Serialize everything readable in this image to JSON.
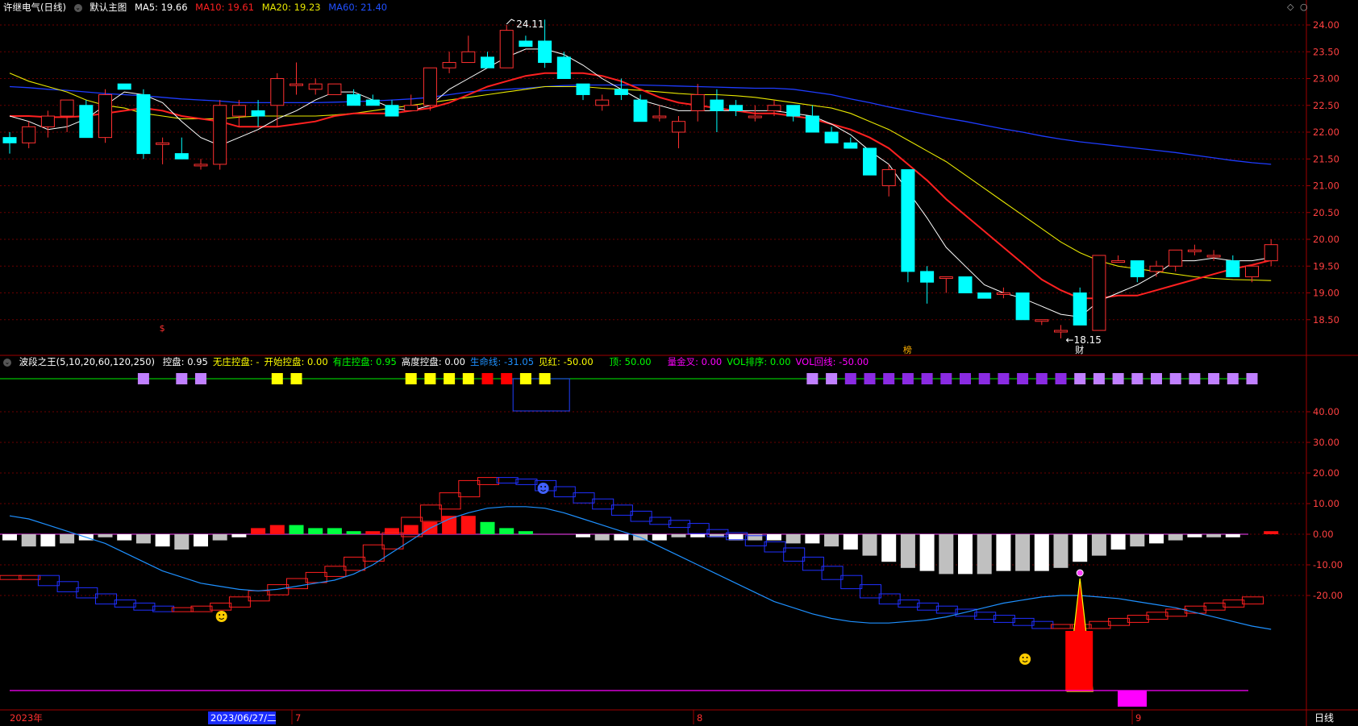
{
  "header_main": {
    "stock_name": "许继电气(日线)",
    "template_label": "默认主图",
    "ma5": "MA5: 19.66",
    "ma10": "MA10: 19.61",
    "ma20": "MA20: 19.23",
    "ma60": "MA60: 21.40"
  },
  "header_indicator": {
    "name": "波段之王(5,10,20,60,120,250)",
    "items": [
      {
        "text": "控盘: 0.95",
        "color": "#ffffff"
      },
      {
        "text": "无庄控盘: -",
        "color": "#ffff00"
      },
      {
        "text": "开始控盘: 0.00",
        "color": "#ffff00"
      },
      {
        "text": "有庄控盘: 0.95",
        "color": "#00ff00"
      },
      {
        "text": "高度控盘: 0.00",
        "color": "#ffffff"
      },
      {
        "text": "生命线: -31.05",
        "color": "#1e90ff"
      },
      {
        "text": "见红: -50.00",
        "color": "#ffff00"
      },
      {
        "text": "顶: 50.00",
        "color": "#00ff00"
      },
      {
        "text": "量金叉: 0.00",
        "color": "#ff00ff"
      },
      {
        "text": "VOL排序: 0.00",
        "color": "#00ff00"
      },
      {
        "text": "VOL回线: -50.00",
        "color": "#ff00ff"
      }
    ]
  },
  "axis_main_labels": [
    "24.00",
    "23.50",
    "23.00",
    "22.50",
    "22.00",
    "21.50",
    "21.00",
    "20.50",
    "20.00",
    "19.50",
    "19.00",
    "18.50"
  ],
  "axis_ind_labels": [
    "40.00",
    "30.00",
    "20.00",
    "10.00",
    "0.00",
    "-10.00",
    "-20.00"
  ],
  "x_labels": {
    "year": "2023年",
    "date_box": "2023/06/27/二",
    "m7": "7",
    "m8": "8",
    "m9": "9",
    "period": "日线"
  },
  "annotations": {
    "high": "24.11",
    "low": "18.15",
    "mark_bang": "榜",
    "mark_cai": "财",
    "mark_s": "$"
  },
  "colors": {
    "up": "#ff3030",
    "down": "#00ffff",
    "ma5": "#ffffff",
    "ma10": "#ff2020",
    "ma20": "#e8e800",
    "ma60": "#1e3cff",
    "grid": "#6b0000"
  },
  "chart_data": [
    {
      "type": "candlestick",
      "title": "许继电气(日线)",
      "ylim": [
        18.1,
        24.2
      ],
      "candles_ohlc": [
        [
          21.9,
          22.0,
          21.6,
          21.8
        ],
        [
          21.8,
          22.2,
          21.7,
          22.1
        ],
        [
          22.1,
          22.4,
          21.9,
          22.3
        ],
        [
          22.3,
          22.6,
          22.0,
          22.6
        ],
        [
          22.5,
          22.6,
          21.9,
          21.9
        ],
        [
          21.9,
          22.8,
          21.8,
          22.7
        ],
        [
          22.9,
          22.9,
          22.8,
          22.8
        ],
        [
          22.7,
          22.8,
          21.5,
          21.6
        ],
        [
          21.8,
          21.9,
          21.4,
          21.8
        ],
        [
          21.6,
          21.9,
          21.5,
          21.5
        ],
        [
          21.4,
          21.5,
          21.3,
          21.4
        ],
        [
          21.4,
          22.6,
          21.3,
          22.5
        ],
        [
          22.3,
          22.6,
          22.1,
          22.5
        ],
        [
          22.4,
          22.6,
          22.1,
          22.3
        ],
        [
          22.5,
          23.1,
          22.1,
          23.0
        ],
        [
          22.9,
          23.3,
          22.7,
          22.9
        ],
        [
          22.8,
          23.0,
          22.7,
          22.9
        ],
        [
          22.7,
          22.9,
          22.7,
          22.9
        ],
        [
          22.7,
          22.8,
          22.5,
          22.5
        ],
        [
          22.6,
          22.7,
          22.5,
          22.5
        ],
        [
          22.5,
          22.6,
          22.3,
          22.3
        ],
        [
          22.4,
          22.7,
          22.4,
          22.5
        ],
        [
          22.5,
          23.2,
          22.4,
          23.2
        ],
        [
          23.2,
          23.5,
          23.1,
          23.3
        ],
        [
          23.3,
          23.8,
          23.3,
          23.5
        ],
        [
          23.4,
          23.5,
          23.3,
          23.2
        ],
        [
          23.2,
          24.0,
          23.2,
          23.9
        ],
        [
          23.7,
          23.8,
          23.6,
          23.6
        ],
        [
          23.7,
          24.1,
          23.2,
          23.3
        ],
        [
          23.4,
          23.5,
          23.0,
          23.0
        ],
        [
          22.9,
          22.9,
          22.6,
          22.7
        ],
        [
          22.5,
          22.7,
          22.4,
          22.6
        ],
        [
          22.8,
          23.0,
          22.6,
          22.7
        ],
        [
          22.6,
          22.7,
          22.3,
          22.2
        ],
        [
          22.3,
          22.5,
          22.2,
          22.3
        ],
        [
          22.0,
          22.3,
          21.7,
          22.2
        ],
        [
          22.4,
          22.9,
          22.2,
          22.7
        ],
        [
          22.6,
          22.8,
          22.0,
          22.4
        ],
        [
          22.5,
          22.6,
          22.3,
          22.4
        ],
        [
          22.3,
          22.5,
          22.2,
          22.3
        ],
        [
          22.4,
          22.6,
          22.3,
          22.5
        ],
        [
          22.5,
          22.5,
          22.2,
          22.3
        ],
        [
          22.3,
          22.5,
          22.0,
          22.0
        ],
        [
          22.0,
          22.1,
          21.8,
          21.8
        ],
        [
          21.8,
          21.9,
          21.7,
          21.7
        ],
        [
          21.7,
          21.7,
          21.2,
          21.2
        ],
        [
          21.0,
          21.4,
          20.8,
          21.3
        ],
        [
          21.3,
          21.3,
          19.2,
          19.4
        ],
        [
          19.4,
          19.5,
          18.8,
          19.2
        ],
        [
          19.3,
          19.3,
          19.0,
          19.3
        ],
        [
          19.3,
          19.3,
          19.0,
          19.0
        ],
        [
          19.0,
          19.0,
          18.9,
          18.9
        ],
        [
          19.0,
          19.1,
          18.9,
          19.0
        ],
        [
          19.0,
          19.0,
          18.5,
          18.5
        ],
        [
          18.5,
          18.5,
          18.4,
          18.5
        ],
        [
          18.3,
          18.4,
          18.15,
          18.3
        ],
        [
          19.0,
          19.1,
          18.4,
          18.4
        ],
        [
          18.3,
          19.7,
          18.3,
          19.7
        ],
        [
          19.6,
          19.7,
          19.6,
          19.6
        ],
        [
          19.6,
          19.6,
          19.2,
          19.3
        ],
        [
          19.4,
          19.6,
          19.3,
          19.5
        ],
        [
          19.5,
          19.8,
          19.4,
          19.8
        ],
        [
          19.8,
          19.9,
          19.7,
          19.8
        ],
        [
          19.7,
          19.8,
          19.6,
          19.7
        ],
        [
          19.6,
          19.7,
          19.3,
          19.3
        ],
        [
          19.3,
          19.5,
          19.2,
          19.5
        ],
        [
          19.6,
          20.0,
          19.5,
          19.9
        ]
      ],
      "ma5": [
        22.3,
        22.2,
        22.05,
        22.1,
        22.25,
        22.5,
        22.75,
        22.7,
        22.55,
        22.2,
        21.9,
        21.75,
        21.9,
        22.05,
        22.25,
        22.4,
        22.6,
        22.75,
        22.75,
        22.6,
        22.45,
        22.4,
        22.5,
        22.8,
        23.0,
        23.2,
        23.4,
        23.55,
        23.55,
        23.45,
        23.25,
        23.0,
        22.8,
        22.6,
        22.5,
        22.4,
        22.4,
        22.4,
        22.4,
        22.4,
        22.4,
        22.35,
        22.3,
        22.15,
        21.95,
        21.65,
        21.4,
        20.9,
        20.4,
        19.85,
        19.5,
        19.15,
        19.0,
        18.9,
        18.75,
        18.6,
        18.55,
        18.85,
        19.0,
        19.15,
        19.35,
        19.6,
        19.6,
        19.65,
        19.6,
        19.6,
        19.66
      ],
      "ma10": [
        22.3,
        22.3,
        22.28,
        22.28,
        22.3,
        22.35,
        22.4,
        22.45,
        22.4,
        22.3,
        22.25,
        22.2,
        22.1,
        22.1,
        22.1,
        22.15,
        22.2,
        22.3,
        22.35,
        22.35,
        22.35,
        22.4,
        22.45,
        22.55,
        22.7,
        22.85,
        22.95,
        23.05,
        23.1,
        23.1,
        23.1,
        23.05,
        22.95,
        22.8,
        22.65,
        22.55,
        22.5,
        22.45,
        22.4,
        22.35,
        22.35,
        22.3,
        22.25,
        22.15,
        22.05,
        21.9,
        21.7,
        21.4,
        21.1,
        20.75,
        20.45,
        20.15,
        19.85,
        19.55,
        19.25,
        19.05,
        18.9,
        18.9,
        18.95,
        18.95,
        19.05,
        19.15,
        19.25,
        19.35,
        19.45,
        19.52,
        19.61
      ],
      "ma20": [
        23.1,
        22.95,
        22.85,
        22.75,
        22.6,
        22.5,
        22.45,
        22.35,
        22.3,
        22.25,
        22.25,
        22.25,
        22.28,
        22.3,
        22.3,
        22.3,
        22.3,
        22.32,
        22.35,
        22.4,
        22.45,
        22.5,
        22.55,
        22.6,
        22.65,
        22.7,
        22.75,
        22.8,
        22.85,
        22.85,
        22.85,
        22.82,
        22.8,
        22.78,
        22.75,
        22.72,
        22.7,
        22.7,
        22.68,
        22.65,
        22.6,
        22.55,
        22.5,
        22.45,
        22.35,
        22.2,
        22.05,
        21.85,
        21.65,
        21.45,
        21.2,
        20.95,
        20.7,
        20.45,
        20.2,
        19.95,
        19.75,
        19.6,
        19.5,
        19.45,
        19.4,
        19.35,
        19.3,
        19.27,
        19.25,
        19.24,
        19.23
      ],
      "ma60": [
        22.85,
        22.83,
        22.8,
        22.78,
        22.75,
        22.72,
        22.7,
        22.68,
        22.65,
        22.62,
        22.6,
        22.58,
        22.55,
        22.55,
        22.55,
        22.55,
        22.55,
        22.56,
        22.57,
        22.58,
        22.6,
        22.62,
        22.65,
        22.7,
        22.75,
        22.78,
        22.8,
        22.82,
        22.85,
        22.87,
        22.88,
        22.88,
        22.88,
        22.88,
        22.87,
        22.86,
        22.85,
        22.84,
        22.83,
        22.82,
        22.82,
        22.8,
        22.75,
        22.7,
        22.62,
        22.55,
        22.47,
        22.4,
        22.33,
        22.26,
        22.2,
        22.13,
        22.06,
        22.0,
        21.93,
        21.87,
        21.82,
        21.78,
        21.74,
        21.7,
        21.66,
        21.62,
        21.57,
        21.52,
        21.47,
        21.43,
        21.4
      ]
    },
    {
      "type": "bar",
      "title": "波段之王(5,10,20,60,120,250)",
      "ylim": [
        -50,
        50
      ],
      "histogram": [
        -2,
        -4,
        -4,
        -3,
        -2,
        -1,
        -2,
        -3,
        -4,
        -5,
        -4,
        -2,
        -1,
        2,
        3,
        3,
        2,
        2,
        1,
        1,
        2,
        3,
        4,
        6,
        6,
        4,
        2,
        1,
        0,
        0,
        -1,
        -2,
        -2,
        -2,
        -2,
        -1,
        -1,
        -1,
        -2,
        -2,
        -2,
        -3,
        -3,
        -4,
        -5,
        -7,
        -9,
        -11,
        -12,
        -13,
        -13,
        -13,
        -12,
        -12,
        -12,
        -11,
        -9,
        -7,
        -5,
        -4,
        -3,
        -2,
        -1,
        -1,
        -1,
        0,
        1
      ],
      "red_ladder": [
        -14,
        -14,
        -14,
        -16,
        -18,
        -20,
        -22,
        -23,
        -24,
        -24.5,
        -24.5,
        -24,
        -23,
        -21,
        -19,
        -17,
        -15,
        -13,
        -11,
        -8,
        -4,
        0,
        5,
        9,
        13,
        17,
        18,
        17.5,
        17,
        15,
        13,
        11,
        9,
        7,
        5,
        4,
        3,
        1,
        0,
        -1,
        -3,
        -5,
        -8,
        -11,
        -14,
        -17,
        -20,
        -22,
        -23,
        -24,
        -25,
        -26,
        -27,
        -28,
        -29,
        -30,
        -30,
        -30,
        -29,
        -28,
        -27,
        -26,
        -25,
        -24,
        -23,
        -22,
        -21
      ],
      "lifeline": [
        6,
        5,
        3,
        1,
        -1,
        -3,
        -6,
        -9,
        -12,
        -14,
        -16,
        -17,
        -18,
        -18.5,
        -18,
        -17,
        -16,
        -15,
        -13,
        -10,
        -6,
        -2,
        2,
        5,
        7,
        8.5,
        9,
        9,
        8.5,
        7,
        5,
        3,
        1,
        -1,
        -4,
        -7,
        -10,
        -13,
        -16,
        -19,
        -22,
        -24,
        -26,
        -27.5,
        -28.5,
        -29,
        -29,
        -28.5,
        -28,
        -27,
        -25.5,
        -24,
        -22.5,
        -21.5,
        -20.5,
        -20,
        -20,
        -20.5,
        -21,
        -22,
        -23,
        -24,
        -25.5,
        -27,
        -28.5,
        -30,
        -31.05
      ],
      "square_markers": [
        {
          "i": 7,
          "c": "#c080ff"
        },
        {
          "i": 9,
          "c": "#c080ff"
        },
        {
          "i": 10,
          "c": "#c080ff"
        },
        {
          "i": 14,
          "c": "#ffff00"
        },
        {
          "i": 15,
          "c": "#ffff00"
        },
        {
          "i": 21,
          "c": "#ffff00"
        },
        {
          "i": 22,
          "c": "#ffff00"
        },
        {
          "i": 23,
          "c": "#ffff00"
        },
        {
          "i": 24,
          "c": "#ffff00"
        },
        {
          "i": 25,
          "c": "#ff0000"
        },
        {
          "i": 26,
          "c": "#ff0000"
        },
        {
          "i": 27,
          "c": "#ffff00"
        },
        {
          "i": 28,
          "c": "#ffff00"
        },
        {
          "i": 42,
          "c": "#c080ff"
        },
        {
          "i": 43,
          "c": "#c080ff"
        },
        {
          "i": 44,
          "c": "#8a2be2"
        },
        {
          "i": 45,
          "c": "#8a2be2"
        },
        {
          "i": 46,
          "c": "#8a2be2"
        },
        {
          "i": 47,
          "c": "#8a2be2"
        },
        {
          "i": 48,
          "c": "#8a2be2"
        },
        {
          "i": 49,
          "c": "#8a2be2"
        },
        {
          "i": 50,
          "c": "#8a2be2"
        },
        {
          "i": 51,
          "c": "#8a2be2"
        },
        {
          "i": 52,
          "c": "#8a2be2"
        },
        {
          "i": 53,
          "c": "#8a2be2"
        },
        {
          "i": 54,
          "c": "#8a2be2"
        },
        {
          "i": 55,
          "c": "#8a2be2"
        },
        {
          "i": 56,
          "c": "#c080ff"
        },
        {
          "i": 57,
          "c": "#c080ff"
        },
        {
          "i": 58,
          "c": "#c080ff"
        },
        {
          "i": 59,
          "c": "#c080ff"
        },
        {
          "i": 60,
          "c": "#c080ff"
        },
        {
          "i": 61,
          "c": "#c080ff"
        },
        {
          "i": 62,
          "c": "#c080ff"
        },
        {
          "i": 63,
          "c": "#c080ff"
        },
        {
          "i": 64,
          "c": "#c080ff"
        },
        {
          "i": 65,
          "c": "#c080ff"
        }
      ],
      "signal_bar_index": 56,
      "signal_bar_range": [
        -44,
        -34
      ]
    }
  ]
}
